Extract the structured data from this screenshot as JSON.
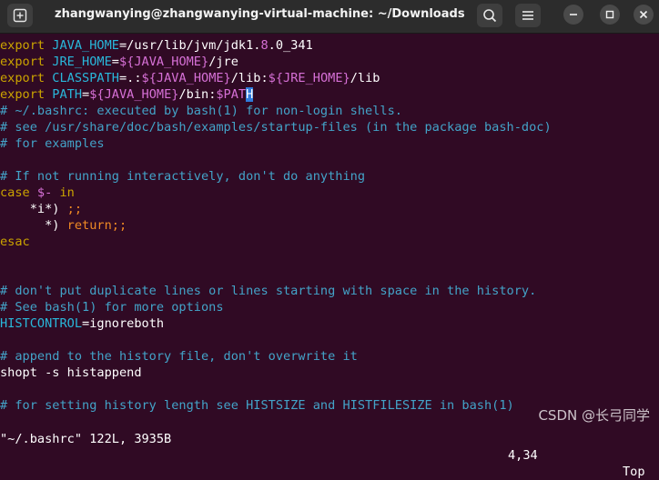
{
  "window": {
    "title": "zhangwanying@zhangwanying-virtual-machine: ~/Downloads",
    "new_tab_icon": "new-tab-icon",
    "search_icon": "search-icon",
    "menu_icon": "hamburger-menu-icon"
  },
  "lines": {
    "l1a": "export ",
    "l1b": "JAVA_HOME",
    "l1c": "=/usr/lib/jvm/jdk1.",
    "l1d": "8",
    "l1e": ".0_341",
    "l2a": "export ",
    "l2b": "JRE_HOME",
    "l2c": "=",
    "l2d": "${JAVA_HOME}",
    "l2e": "/jre",
    "l3a": "export ",
    "l3b": "CLASSPATH",
    "l3c": "=.:",
    "l3d": "${JAVA_HOME}",
    "l3e": "/lib:",
    "l3f": "${JRE_HOME}",
    "l3g": "/lib",
    "l4a": "export ",
    "l4b": "PATH",
    "l4c": "=",
    "l4d": "${JAVA_HOME}",
    "l4e": "/bin:",
    "l4f": "$PAT",
    "l4g": "H",
    "l5": "# ~/.bashrc: executed by bash(1) for non-login shells.",
    "l6": "# see /usr/share/doc/bash/examples/startup-files (in the package bash-doc)",
    "l7": "# for examples",
    "l9": "# If not running interactively, don't do anything",
    "l10a": "case ",
    "l10b": "$-",
    "l10c": " in",
    "l11a": "    *i*) ",
    "l11b": ";;",
    "l12a": "      *) ",
    "l12b": "return",
    "l12c": ";;",
    "l13": "esac",
    "l16": "# don't put duplicate lines or lines starting with space in the history.",
    "l17": "# See bash(1) for more options",
    "l18a": "HISTCONTROL",
    "l18b": "=ignoreboth",
    "l20": "# append to the history file, don't overwrite it",
    "l21": "shopt -s histappend",
    "l23": "# for setting history length see HISTSIZE and HISTFILESIZE in bash(1)"
  },
  "status": {
    "file": "\"~/.bashrc\" 122L, 3935B",
    "position": "4,34",
    "scroll": "Top"
  },
  "watermark": "CSDN @长弓同学"
}
